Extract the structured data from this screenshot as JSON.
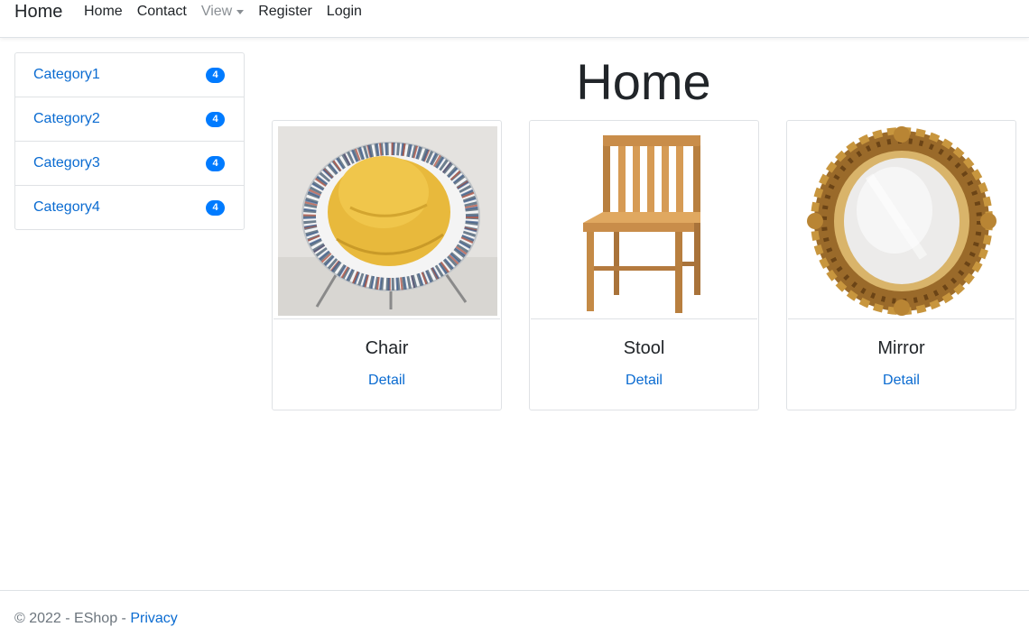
{
  "navbar": {
    "brand": "Home",
    "links": [
      {
        "label": "Home"
      },
      {
        "label": "Contact"
      },
      {
        "label": "View",
        "dropdown": true
      },
      {
        "label": "Register"
      },
      {
        "label": "Login"
      }
    ]
  },
  "sidebar": {
    "categories": [
      {
        "label": "Category1",
        "count": "4"
      },
      {
        "label": "Category2",
        "count": "4"
      },
      {
        "label": "Category3",
        "count": "4"
      },
      {
        "label": "Category4",
        "count": "4"
      }
    ]
  },
  "main": {
    "title": "Home",
    "products": [
      {
        "name": "Chair",
        "detail_label": "Detail",
        "image": "chair-image"
      },
      {
        "name": "Stool",
        "detail_label": "Detail",
        "image": "stool-image"
      },
      {
        "name": "Mirror",
        "detail_label": "Detail",
        "image": "mirror-image"
      }
    ]
  },
  "footer": {
    "text": "© 2022 - EShop - ",
    "privacy_label": "Privacy"
  },
  "colors": {
    "link": "#0a6bd1",
    "badge": "#007bff",
    "border": "#dfe2e5"
  }
}
